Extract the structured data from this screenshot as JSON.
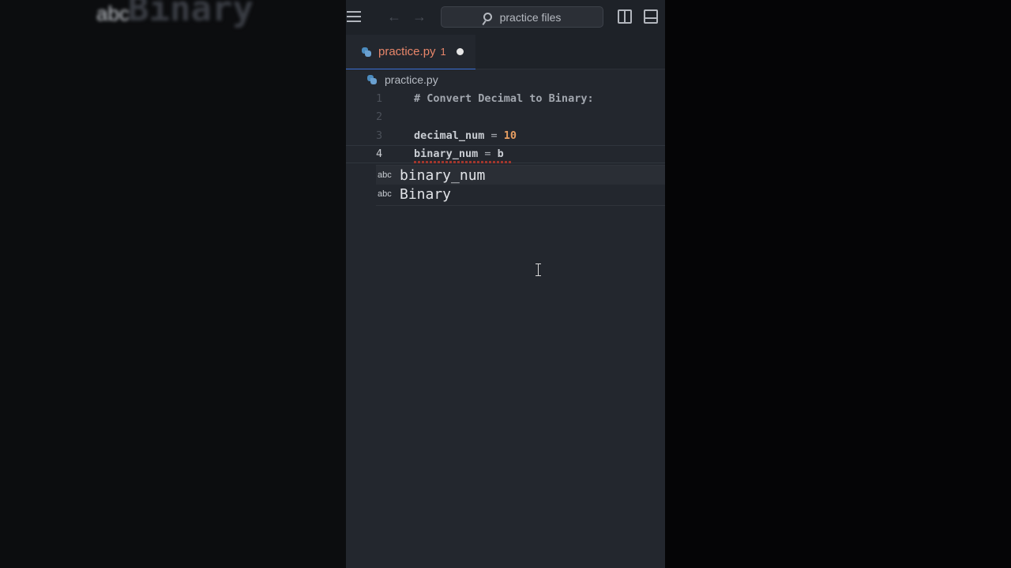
{
  "background_ghost": {
    "abc": "abc",
    "word": "Binary"
  },
  "titlebar": {
    "menu_icon": "menu-icon",
    "back_icon": "arrow-left-icon",
    "forward_icon": "arrow-right-icon",
    "search_placeholder": "practice files",
    "layout_icons": [
      "split-editor-icon",
      "toggle-panel-icon"
    ]
  },
  "tab": {
    "label": "practice.py",
    "problem_count": "1",
    "dirty": true,
    "label_color": "#e8866a"
  },
  "breadcrumb": {
    "file": "practice.py"
  },
  "code": {
    "lines": [
      {
        "number": "1",
        "text": "# Convert Decimal to Binary:"
      },
      {
        "number": "2",
        "text": ""
      },
      {
        "number": "3",
        "ident": "decimal_num",
        "op": " = ",
        "value": "10"
      },
      {
        "number": "4",
        "ident": "binary_num",
        "op": " = ",
        "value": "b"
      }
    ]
  },
  "suggestions": [
    {
      "kind": "abc",
      "word": "binary_num"
    },
    {
      "kind": "abc",
      "word": "Binary"
    }
  ],
  "colors": {
    "editor_bg": "#23272e",
    "accent": "#3b6fd6",
    "number": "#e69e62",
    "error": "#c0392b"
  }
}
